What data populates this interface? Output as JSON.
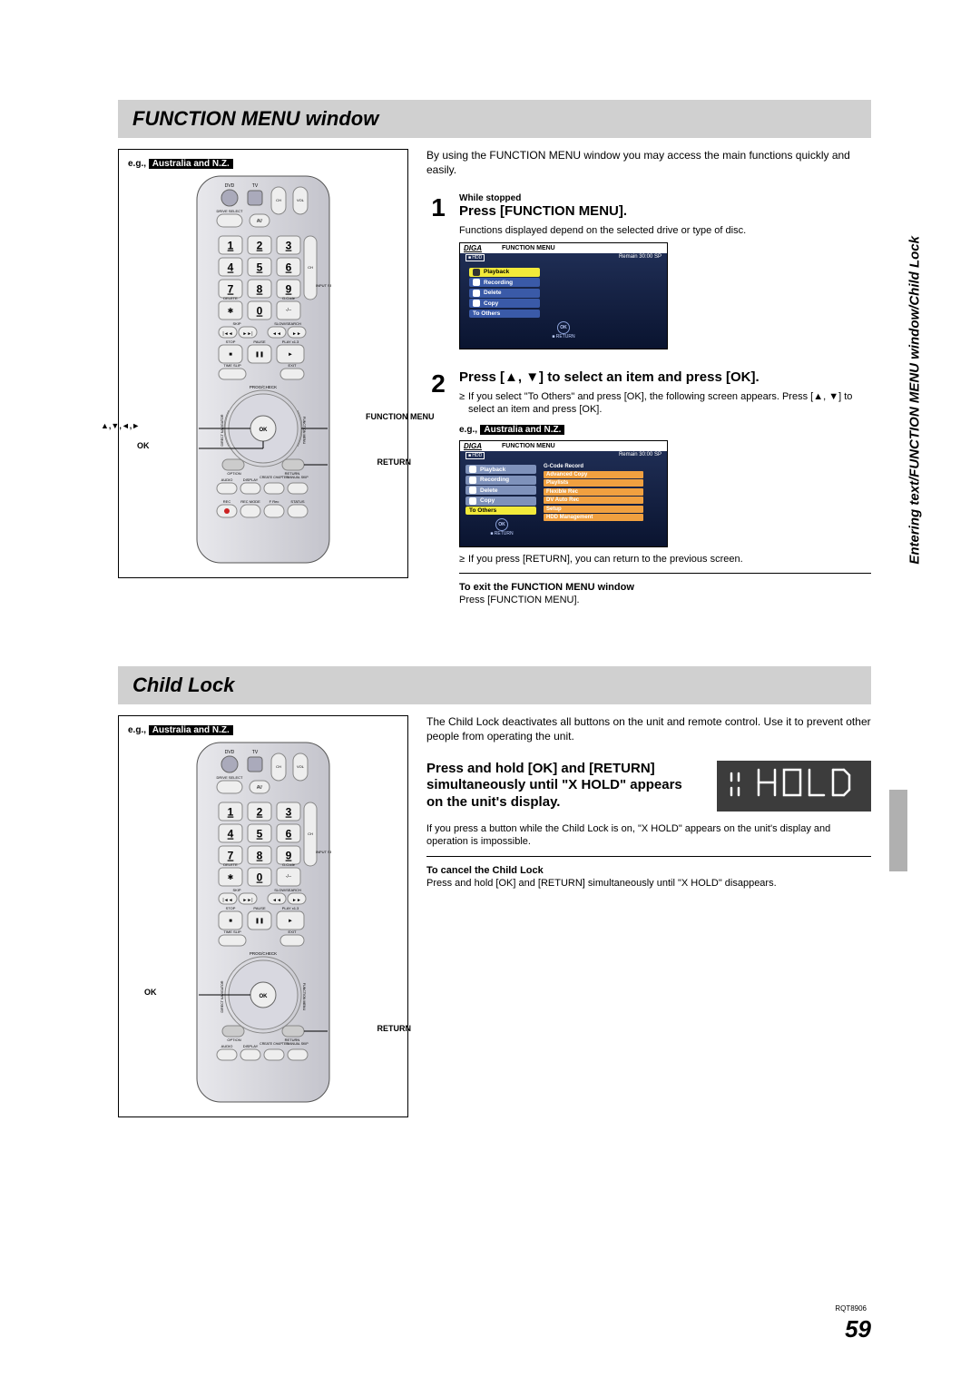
{
  "sec1": {
    "header": "FUNCTION MENU window",
    "eg": "e.g.,",
    "tag": "Australia and N.Z.",
    "intro": "By using the FUNCTION MENU window you may access the main functions quickly and easily.",
    "step1_num": "1",
    "step1_note": "While stopped",
    "step1_head": "Press [FUNCTION MENU].",
    "step1_body": "Functions displayed depend on the selected drive or type of disc.",
    "step2_num": "2",
    "step2_head": "Press [▲, ▼] to select an item and press [OK].",
    "step2_b1": "If you select \"To Others\" and press [OK], the following screen appears. Press [▲, ▼] to select an item and press [OK].",
    "step2_b2": "If you press [RETURN], you can return to the previous screen.",
    "exit_head": "To exit the FUNCTION MENU window",
    "exit_body": "Press [FUNCTION MENU].",
    "callouts": {
      "arrows": "▲,▼,◄,►",
      "ok": "OK",
      "func": "FUNCTION MENU",
      "return": "RETURN"
    },
    "osd": {
      "brand": "DIGA",
      "title": "FUNCTION MENU",
      "drive": "HDD",
      "remain": "Remain  30:00 SP",
      "items": [
        "Playback",
        "Recording",
        "Delete",
        "Copy",
        "To Others"
      ],
      "sub_head": "G-Code Record",
      "subs": [
        "Advanced Copy",
        "Playlists",
        "Flexible Rec",
        "DV Auto Rec",
        "Setup",
        "HDD Management"
      ],
      "ok": "OK",
      "return": "RETURN"
    }
  },
  "sec2": {
    "header": "Child Lock",
    "eg": "e.g.,",
    "tag": "Australia and N.Z.",
    "intro": "The Child Lock deactivates all buttons on the unit and remote control. Use it to prevent other people from operating the unit.",
    "step_head": "Press and hold [OK] and [RETURN] simultaneously until \"X HOLD\" appears on the unit's display.",
    "body1": "If you press a button while the Child Lock is on, \"X HOLD\" appears on the unit's display and operation is impossible.",
    "cancel_head": "To cancel the Child Lock",
    "cancel_body": "Press and hold [OK] and [RETURN] simultaneously until \"X HOLD\" disappears.",
    "callouts": {
      "ok": "OK",
      "return": "RETURN"
    },
    "hold_display": "X HOLD"
  },
  "remote": {
    "keys": [
      "1",
      "2",
      "3",
      "4",
      "5",
      "6",
      "7",
      "8",
      "9",
      "0"
    ],
    "labels": {
      "dvd": "DVD",
      "tv": "TV",
      "ch": "CH",
      "vol": "VOL",
      "av": "AV",
      "drive": "DRIVE SELECT",
      "input": "INPUT SELECT",
      "gcode": "G-Code",
      "delete": "DELETE",
      "skip": "SKIP",
      "slow": "SLOW/SEARCH",
      "stop": "STOP",
      "pause": "PAUSE",
      "play": "PLAY x1.3",
      "timeslip": "TIME SLIP",
      "exit": "EXIT",
      "prog": "PROG/CHECK",
      "direct": "DIRECT NAVIGATOR",
      "func": "FUNCTION MENU",
      "option": "OPTION",
      "return": "RETURN",
      "audio": "AUDIO",
      "display": "DISPLAY",
      "create": "CREATE CHAPTER",
      "manual": "MANUAL SKIP",
      "rec": "REC",
      "recmode": "REC MODE",
      "frec": "F Rec",
      "status": "STATUS",
      "ok": "OK"
    }
  },
  "sidebar": "Entering text/FUNCTION MENU window/Child Lock",
  "page_number": "59",
  "doc_id": "RQT8906"
}
